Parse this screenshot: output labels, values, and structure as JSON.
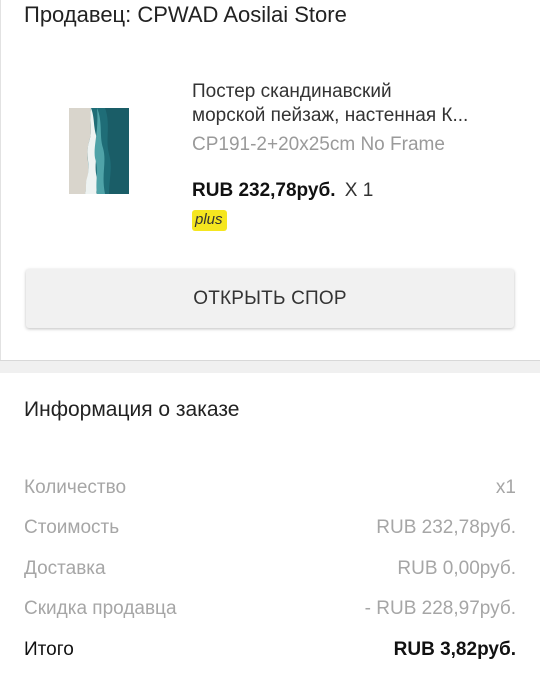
{
  "seller": {
    "label": "Продавец: CPWAD Aosilai Store"
  },
  "product": {
    "title_line1": "Постер скандинавский",
    "title_line2": "морской пейзаж, настенная К...",
    "variant": "CP191-2+20x25cm No Frame",
    "price": "RUB 232,78руб.",
    "quantity": "X 1",
    "badge": "plus",
    "badge_color": "#f5e61f"
  },
  "actions": {
    "open_dispute": "ОТКРЫТЬ СПОР"
  },
  "order_info": {
    "title": "Информация о заказе",
    "rows": [
      {
        "label": "Количество",
        "value": "x1"
      },
      {
        "label": "Стоимость",
        "value": "RUB 232,78руб."
      },
      {
        "label": "Доставка",
        "value": "RUB 0,00руб."
      },
      {
        "label": "Скидка продавца",
        "value": "- RUB 228,97руб."
      },
      {
        "label": "Итого",
        "value": "RUB 3,82руб."
      }
    ]
  }
}
